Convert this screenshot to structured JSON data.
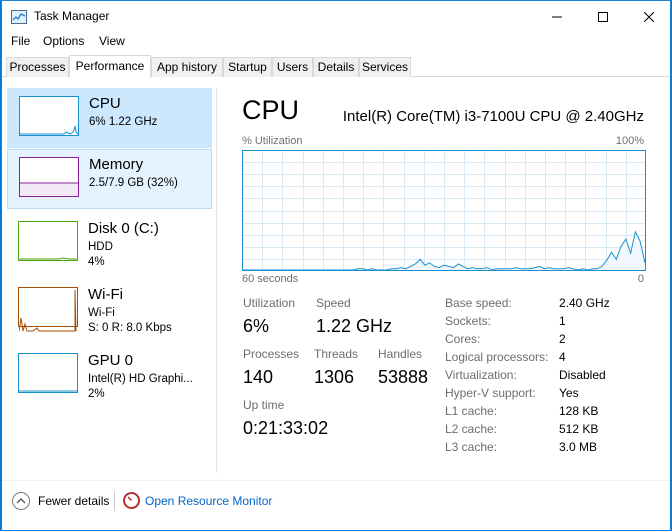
{
  "window": {
    "title": "Task Manager",
    "controls": {
      "minimize": "─",
      "maximize": "☐",
      "close": "✕"
    }
  },
  "menu": [
    "File",
    "Options",
    "View"
  ],
  "tabs": [
    {
      "label": "Processes",
      "active": false
    },
    {
      "label": "Performance",
      "active": true
    },
    {
      "label": "App history",
      "active": false
    },
    {
      "label": "Startup",
      "active": false
    },
    {
      "label": "Users",
      "active": false
    },
    {
      "label": "Details",
      "active": false
    },
    {
      "label": "Services",
      "active": false
    }
  ],
  "resources": [
    {
      "name": "CPU",
      "line1": "6%  1.22 GHz",
      "line2": "",
      "color": "#1a8fd0"
    },
    {
      "name": "Memory",
      "line1": "2.5/7.9 GB (32%)",
      "line2": "",
      "color": "#8b1f9e"
    },
    {
      "name": "Disk 0 (C:)",
      "line1": "HDD",
      "line2": "4%",
      "color": "#4da60c"
    },
    {
      "name": "Wi-Fi",
      "line1": "Wi-Fi",
      "line2": "S: 0  R: 8.0 Kbps",
      "color": "#a74f01"
    },
    {
      "name": "GPU 0",
      "line1": "Intel(R) HD Graphi...",
      "line2": "2%",
      "color": "#1a8fd0"
    }
  ],
  "cpu": {
    "heading": "CPU",
    "model": "Intel(R) Core(TM) i3-7100U CPU @ 2.40GHz",
    "graph_label": "% Utilization",
    "graph_max": "100%",
    "time_span": "60 seconds",
    "graph_min": "0",
    "history": [
      0,
      0,
      0,
      0,
      0,
      0,
      0,
      0,
      0,
      0,
      0,
      0,
      0,
      0,
      0,
      0,
      0,
      0,
      0,
      0,
      0,
      0,
      0,
      0,
      1,
      1,
      0,
      1,
      0,
      0,
      0,
      1,
      1,
      2,
      1,
      3,
      5,
      9,
      4,
      6,
      3,
      2,
      4,
      3,
      2,
      5,
      3,
      1,
      2,
      1,
      1,
      2,
      0,
      1,
      1,
      1,
      1,
      2,
      1,
      1,
      1,
      2,
      3,
      1,
      2,
      1,
      1,
      1,
      2,
      1,
      0,
      1,
      0,
      1,
      1,
      3,
      8,
      15,
      9,
      20,
      26,
      14,
      32,
      24,
      6
    ],
    "stats": {
      "utilization_label": "Utilization",
      "utilization": "6%",
      "speed_label": "Speed",
      "speed": "1.22 GHz",
      "processes_label": "Processes",
      "processes": "140",
      "threads_label": "Threads",
      "threads": "1306",
      "handles_label": "Handles",
      "handles": "53888",
      "uptime_label": "Up time",
      "uptime": "0:21:33:02"
    },
    "specs": [
      {
        "label": "Base speed:",
        "value": "2.40 GHz"
      },
      {
        "label": "Sockets:",
        "value": "1"
      },
      {
        "label": "Cores:",
        "value": "2"
      },
      {
        "label": "Logical processors:",
        "value": "4"
      },
      {
        "label": "Virtualization:",
        "value": "Disabled"
      },
      {
        "label": "Hyper-V support:",
        "value": "Yes"
      },
      {
        "label": "L1 cache:",
        "value": "128 KB"
      },
      {
        "label": "L2 cache:",
        "value": "512 KB"
      },
      {
        "label": "L3 cache:",
        "value": "3.0 MB"
      }
    ]
  },
  "footer": {
    "fewer_details": "Fewer details",
    "open_resource_monitor": "Open Resource Monitor"
  },
  "colors": {
    "graph_line": "#1a8fd0",
    "graph_grid": "#d9eaf7",
    "graph_border": "#1a8fd0",
    "selected_bg": "#cce8ff",
    "link": "#0066cc"
  }
}
